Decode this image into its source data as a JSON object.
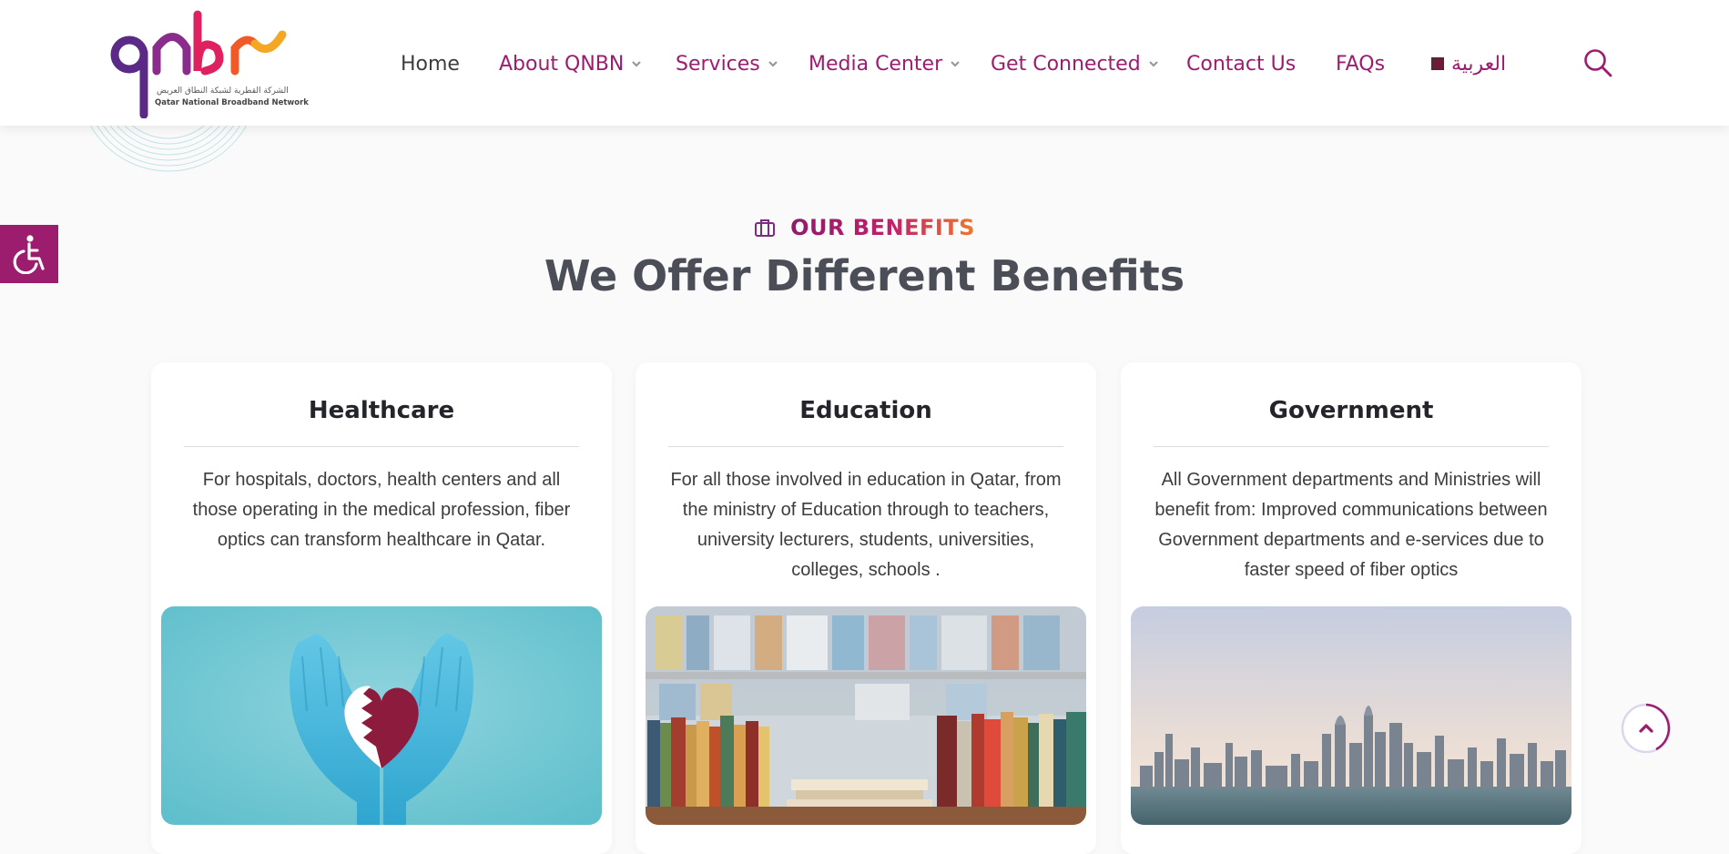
{
  "brand": {
    "logo_mark": "qnbn",
    "logo_arabic": "الشركة القطرية لشبكة النطاق العريض",
    "logo_english": "Qatar National Broadband Network"
  },
  "nav": {
    "items": [
      {
        "label": "Home",
        "dropdown": false
      },
      {
        "label": "About QNBN",
        "dropdown": true
      },
      {
        "label": "Services",
        "dropdown": true
      },
      {
        "label": "Media Center",
        "dropdown": true
      },
      {
        "label": "Get Connected",
        "dropdown": true
      },
      {
        "label": "Contact Us",
        "dropdown": false
      },
      {
        "label": "FAQs",
        "dropdown": false
      },
      {
        "label": "العربية",
        "dropdown": false
      }
    ],
    "search_icon": "search-icon"
  },
  "accessibility": {
    "icon": "wheelchair-icon"
  },
  "section": {
    "eyebrow_icon": "briefcase-icon",
    "eyebrow": "OUR BENEFITS",
    "title": "We Offer Different Benefits"
  },
  "cards": [
    {
      "title": "Healthcare",
      "description": "For hospitals, doctors, health centers and all those operating in the medical profession, fiber optics can transform healthcare in Qatar.",
      "image": "gloved-hands-holding-heart"
    },
    {
      "title": "Education",
      "description": "For all those involved in education in Qatar, from the ministry of Education through to teachers, university lecturers, students, universities, colleges, schools .",
      "image": "books-on-shelf"
    },
    {
      "title": "Government",
      "description": "All Government departments and Ministries will benefit from: Improved communications between Government departments and e-services due to faster speed of fiber optics",
      "image": "city-skyline"
    }
  ],
  "scroll_top": {
    "icon": "chevron-up-icon"
  },
  "colors": {
    "brand": "#9c1c6e",
    "heading": "#4b4e57",
    "accent_orange": "#f0792b",
    "background": "#fafafa"
  }
}
